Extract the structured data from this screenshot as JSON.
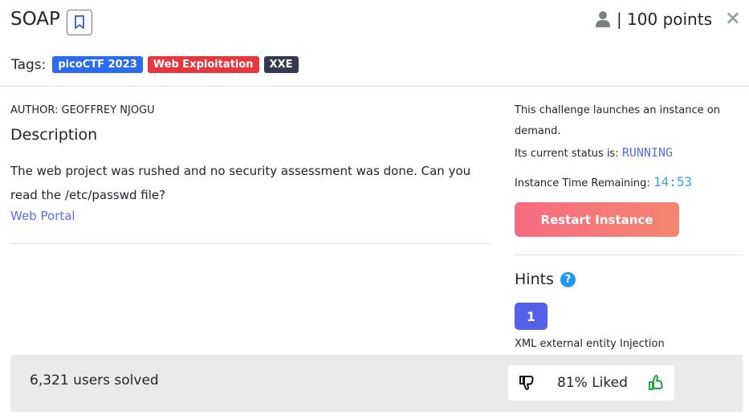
{
  "challenge": {
    "title": "SOAP",
    "points_text": "| 100 points",
    "close_glyph": "×"
  },
  "tags": {
    "label": "Tags:",
    "items": [
      {
        "text": "picoCTF 2023",
        "color": "#2c6bf0"
      },
      {
        "text": "Web Exploitation",
        "color": "#e8363f"
      },
      {
        "text": "XXE",
        "color": "#343a4f"
      }
    ]
  },
  "author": "AUTHOR: GEOFFREY NJOGU",
  "description": {
    "heading": "Description",
    "text": "The web project was rushed and no security assessment was done. Can you read the /etc/passwd file?",
    "link_text": "Web Portal"
  },
  "instance": {
    "launch_text": "This challenge launches an instance on demand.",
    "status_label": "Its current status is:",
    "status_value": "RUNNING",
    "time_label": "Instance Time Remaining:",
    "time_value": "14:53",
    "restart_label": "Restart Instance"
  },
  "hints": {
    "heading": "Hints",
    "help_glyph": "?",
    "items": [
      {
        "number": "1",
        "text": "XML external entity Injection"
      }
    ]
  },
  "footer": {
    "solved_text": "6,321 users solved",
    "liked_text": "81% Liked"
  },
  "icons": {
    "bookmark": "bookmark-icon",
    "user": "user-icon",
    "close": "close-icon",
    "dislike": "thumbs-down-icon",
    "like": "thumbs-up-icon",
    "help": "question-circle-icon"
  }
}
